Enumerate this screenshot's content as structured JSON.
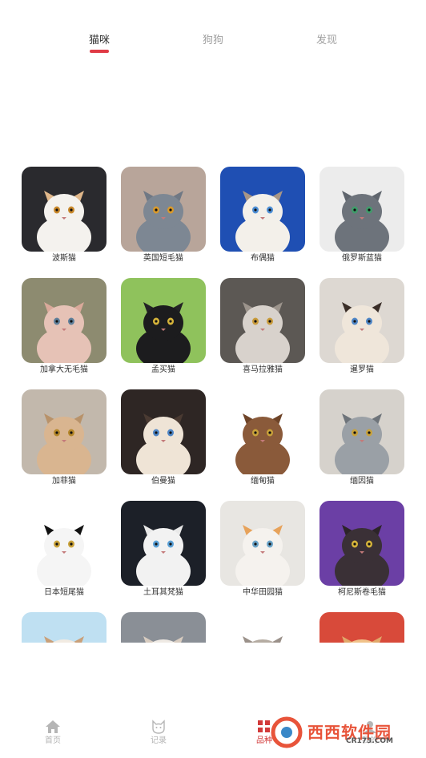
{
  "tabs": [
    {
      "label": "猫咪",
      "active": true
    },
    {
      "label": "狗狗",
      "active": false
    },
    {
      "label": "发现",
      "active": false
    }
  ],
  "colors": {
    "accent": "#e03a45",
    "inactive": "#a0a0a0",
    "text": "#333333"
  },
  "cats": [
    {
      "label": "波斯猫",
      "bg": "#2a2a2e",
      "fur": "#f4f2ee",
      "patch": "#e0b78a",
      "eye": "#c9882a"
    },
    {
      "label": "英国短毛猫",
      "bg": "#b8a59a",
      "fur": "#7d8793",
      "patch": "#6f7884",
      "eye": "#d99a2b"
    },
    {
      "label": "布偶猫",
      "bg": "#1f4fb3",
      "fur": "#f3f0ea",
      "patch": "#a89686",
      "eye": "#4d8fd6"
    },
    {
      "label": "俄罗斯蓝猫",
      "bg": "#ececec",
      "fur": "#6d737b",
      "patch": "#5f656d",
      "eye": "#3f9c6a"
    },
    {
      "label": "加拿大无毛猫",
      "bg": "#8d8b70",
      "fur": "#e6c2b6",
      "patch": "#d9a99a",
      "eye": "#5f7f9a"
    },
    {
      "label": "孟买猫",
      "bg": "#8fc25c",
      "fur": "#1c1c1e",
      "patch": "#232325",
      "eye": "#d6b43a"
    },
    {
      "label": "喜马拉雅猫",
      "bg": "#5c5854",
      "fur": "#d8d2cc",
      "patch": "#9c948c",
      "eye": "#c99b3a"
    },
    {
      "label": "暹罗猫",
      "bg": "#ddd8d2",
      "fur": "#efe6da",
      "patch": "#3a2e28",
      "eye": "#4f86c6"
    },
    {
      "label": "加菲猫",
      "bg": "#c2b8ac",
      "fur": "#d9b590",
      "patch": "#b8926a",
      "eye": "#b5872a"
    },
    {
      "label": "伯曼猫",
      "bg": "#2e2624",
      "fur": "#efe4d6",
      "patch": "#4a3a32",
      "eye": "#4f86c6"
    },
    {
      "label": "缅甸猫",
      "bg": "#ffffff",
      "fur": "#8a5a3a",
      "patch": "#6e4428",
      "eye": "#c9a23a"
    },
    {
      "label": "缅因猫",
      "bg": "#d6d2cc",
      "fur": "#9aa0a6",
      "patch": "#6e747a",
      "eye": "#c9a23a"
    },
    {
      "label": "日本短尾猫",
      "bg": "#ffffff",
      "fur": "#f5f5f5",
      "patch": "#111111",
      "eye": "#c9a23a"
    },
    {
      "label": "土耳其梵猫",
      "bg": "#1c2028",
      "fur": "#f2f2f2",
      "patch": "#e8e8e8",
      "eye": "#5aa0d6"
    },
    {
      "label": "中华田园猫",
      "bg": "#e8e6e2",
      "fur": "#f5f2ee",
      "patch": "#e7a25a",
      "eye": "#6aa3c8"
    },
    {
      "label": "柯尼斯卷毛猫",
      "bg": "#6b3fa5",
      "fur": "#3a3036",
      "patch": "#2c2428",
      "eye": "#d6b43a"
    },
    {
      "label": "",
      "bg": "#bfe0f2",
      "fur": "#f2ebe2",
      "patch": "#c9a07a",
      "eye": "#3f6f9a"
    },
    {
      "label": "",
      "bg": "#8a8f96",
      "fur": "#efeae4",
      "patch": "#d8ccc0",
      "eye": "#5a86b0"
    },
    {
      "label": "",
      "bg": "#ffffff",
      "fur": "#b5aca2",
      "patch": "#9b918a",
      "eye": "#c9a23a"
    },
    {
      "label": "",
      "bg": "#d84a3a",
      "fur": "#f0c28a",
      "patch": "#e0a86a",
      "eye": "#3a2a20"
    }
  ],
  "nav": [
    {
      "label": "首页",
      "icon": "home-icon"
    },
    {
      "label": "记录",
      "icon": "cat-face-icon"
    },
    {
      "label": "品种",
      "icon": "grid-icon"
    },
    {
      "label": "我的",
      "icon": "user-icon"
    }
  ],
  "watermark": {
    "text": "西西软件园",
    "site": "CR173.COM"
  }
}
